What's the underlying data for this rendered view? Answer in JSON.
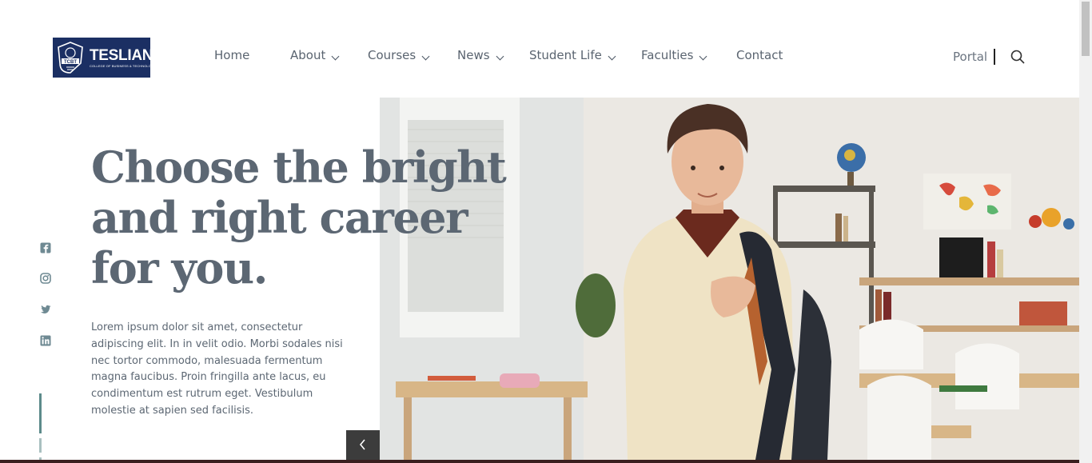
{
  "brand": {
    "name": "TESLIAN",
    "crest_text": "TCBT",
    "tagline": "COLLEGE OF BUSINESS & TECHNOLOGY",
    "color": "#1b2f63"
  },
  "nav": {
    "items": [
      {
        "label": "Home",
        "has_dropdown": false
      },
      {
        "label": "About",
        "has_dropdown": true
      },
      {
        "label": "Courses",
        "has_dropdown": true
      },
      {
        "label": "News",
        "has_dropdown": true
      },
      {
        "label": "Student Life",
        "has_dropdown": true
      },
      {
        "label": "Faculties",
        "has_dropdown": true
      },
      {
        "label": "Contact",
        "has_dropdown": false
      }
    ],
    "portal_label": "Portal",
    "search_icon": "search-icon"
  },
  "hero": {
    "headline": "Choose the bright and right career for you.",
    "body": "Lorem ipsum dolor sit amet, consectetur adipiscing elit. In in velit odio. Morbi sodales nisi nec tortor commodo, malesuada fermentum magna faucibus. Proin fringilla ante lacus, eu condimentum est rutrum eget. Vestibulum molestie at sapien sed facilisis.",
    "prev_icon": "chevron-left-icon"
  },
  "socials": [
    "facebook-icon",
    "instagram-icon",
    "twitter-icon",
    "linkedin-icon"
  ],
  "colors": {
    "text": "#5c6773",
    "accent": "#5d8b8b",
    "dark_button": "#3c3c3c"
  }
}
